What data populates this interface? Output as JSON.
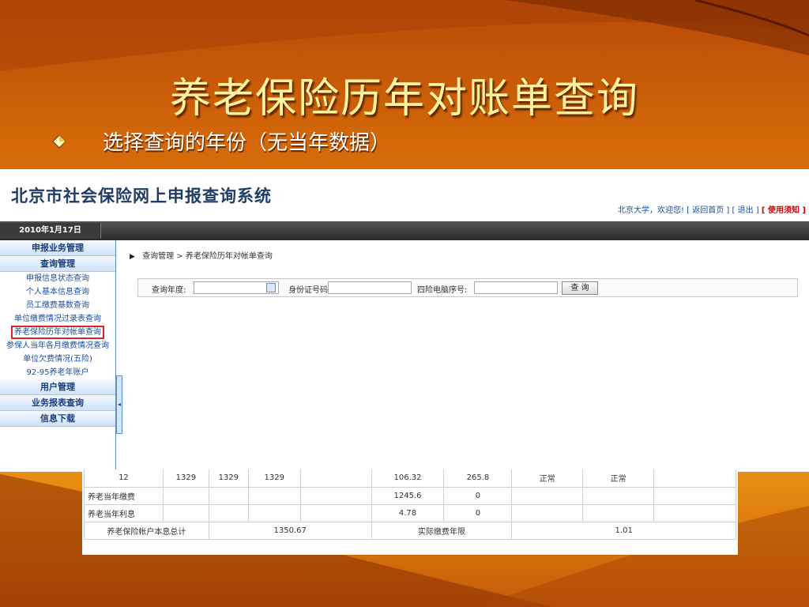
{
  "slide": {
    "title": "养老保险历年对账单查询",
    "subtitle": "选择查询的年份（无当年数据）"
  },
  "app": {
    "system_title": "北京市社会保险网上申报查询系统",
    "user": "北京大学，欢迎您!",
    "links": [
      "[ 返回首页 ]",
      "[ 退出 ]",
      "[ 使用须知 ]"
    ],
    "date": "2010年1月17日"
  },
  "sidebar": {
    "sections": [
      {
        "label": "申报业务管理",
        "items": []
      },
      {
        "label": "查询管理",
        "items": [
          "申报信息状态查询",
          "个人基本信息查询",
          "员工缴费基数查询",
          "单位缴费情况过录表查询",
          "养老保险历年对帐单查询",
          "参保人当年各月缴费情况查询",
          "单位欠费情况(五险)",
          "92-95养老年账户"
        ]
      },
      {
        "label": "用户管理",
        "items": []
      },
      {
        "label": "业务报表查询",
        "items": []
      },
      {
        "label": "信息下载",
        "items": []
      }
    ],
    "active_item": "养老保险历年对帐单查询",
    "handle_glyph": "◂"
  },
  "main": {
    "breadcrumb": "查询管理 > 养老保险历年对帐单查询",
    "query": {
      "year_label": "查询年度:",
      "year_value": "",
      "id_label": "身份证号码:",
      "id_value": "",
      "code_label": "四险电脑序号:",
      "code_value": "",
      "button": "查 询"
    }
  },
  "table": {
    "rows": [
      [
        "12",
        "1329",
        "1329",
        "1329",
        "",
        "106.32",
        "265.8",
        "正常",
        "正常",
        ""
      ],
      [
        "养老当年缴费",
        "",
        "",
        "",
        "",
        "1245.6",
        "0",
        "",
        "",
        ""
      ],
      [
        "养老当年利息",
        "",
        "",
        "",
        "",
        "4.78",
        "0",
        "",
        "",
        ""
      ]
    ],
    "summary": {
      "label": "养老保险帐户本息总计",
      "total": "1350.67",
      "years_label": "实际缴费年限",
      "years": "1.01"
    }
  }
}
